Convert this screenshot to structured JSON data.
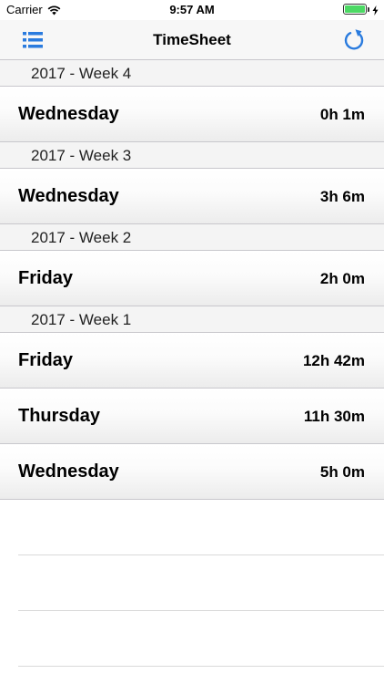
{
  "status_bar": {
    "carrier": "Carrier",
    "time": "9:57 AM"
  },
  "nav": {
    "title": "TimeSheet",
    "menu_icon": "list-icon",
    "refresh_icon": "refresh-icon"
  },
  "colors": {
    "accent": "#2a7bde",
    "battery": "#4cd964",
    "separator": "#c8c7cc",
    "section_background": "#f4f4f4"
  },
  "sections": [
    {
      "header": "2017 - Week 4",
      "days": [
        {
          "day": "Wednesday",
          "hours": "0h 1m"
        }
      ]
    },
    {
      "header": "2017 - Week 3",
      "days": [
        {
          "day": "Wednesday",
          "hours": "3h 6m"
        }
      ]
    },
    {
      "header": "2017 - Week 2",
      "days": [
        {
          "day": "Friday",
          "hours": "2h 0m"
        }
      ]
    },
    {
      "header": "2017 - Week 1",
      "days": [
        {
          "day": "Friday",
          "hours": "12h 42m"
        },
        {
          "day": "Thursday",
          "hours": "11h 30m"
        },
        {
          "day": "Wednesday",
          "hours": "5h 0m"
        }
      ]
    }
  ]
}
